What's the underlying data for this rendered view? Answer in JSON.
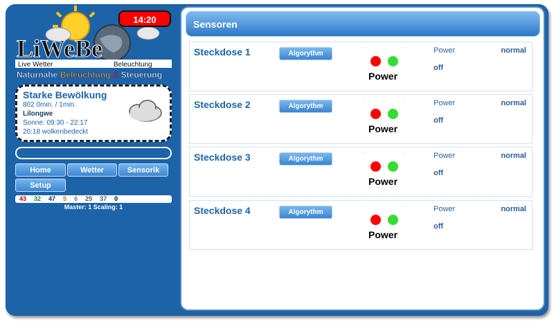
{
  "header": {
    "clock": "14:20",
    "logo_text": "LiWeBe",
    "logo_left": "Live Wetter",
    "logo_right": "Beleuchtung",
    "tagline_1": "Naturnahe",
    "tagline_2": "Beleuchtung",
    "tagline_3": "&",
    "tagline_4": "Steuerung"
  },
  "weather": {
    "condition": "Starke Bewölkung",
    "line1": "802 0min. / 1min.",
    "location": "Lilongwe",
    "sun": "Sonne: 09:30 - 22:17",
    "forecast": "20:18 wolkenbedeckt",
    "icon": "cloud-icon"
  },
  "nav": {
    "home": "Home",
    "wetter": "Wetter",
    "sensorik": "Sensorik",
    "setup": "Setup"
  },
  "stats": {
    "values": [
      "43",
      "32",
      "47",
      "5",
      "6",
      "25",
      "37",
      "0"
    ],
    "colors": [
      "#cc0000",
      "#1f8a1f",
      "#1a2a80",
      "#d07000",
      "#777777",
      "#555555",
      "#555555",
      "#000000"
    ]
  },
  "master": "Master: 1 Scaling: 1",
  "main": {
    "title": "Sensoren",
    "rows": [
      {
        "name": "Steckdose 1",
        "button": "Algorythm",
        "power": "Power",
        "label": "Power",
        "status": "normal",
        "state": "off"
      },
      {
        "name": "Steckdose 2",
        "button": "Algorythm",
        "power": "Power",
        "label": "Power",
        "status": "normal",
        "state": "off"
      },
      {
        "name": "Steckdose 3",
        "button": "Algorythm",
        "power": "Power",
        "label": "Power",
        "status": "normal",
        "state": "off"
      },
      {
        "name": "Steckdose 4",
        "button": "Algorythm",
        "power": "Power",
        "label": "Power",
        "status": "normal",
        "state": "off"
      }
    ]
  }
}
